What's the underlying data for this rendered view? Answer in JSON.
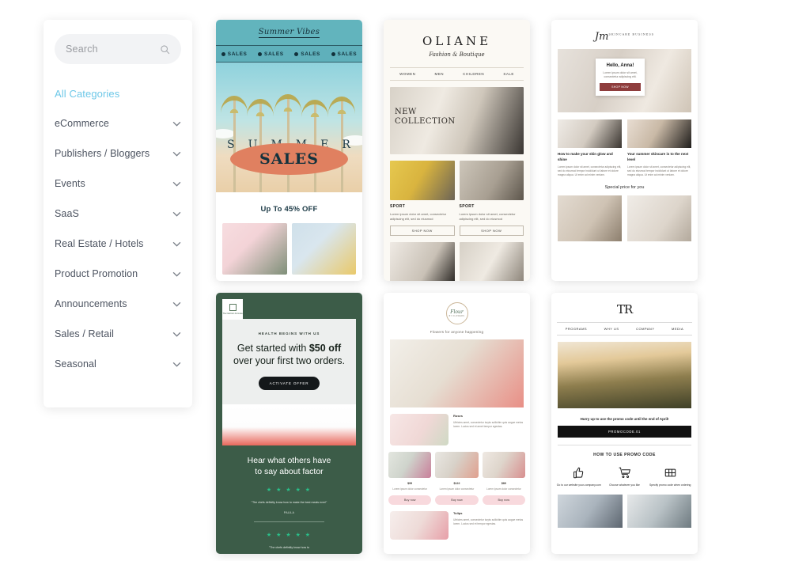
{
  "sidebar": {
    "search": {
      "placeholder": "Search",
      "value": "",
      "icon": "search-icon"
    },
    "all_categories": "All Categories",
    "items": [
      {
        "label": "eCommerce",
        "icon": "chevron-down-icon"
      },
      {
        "label": "Publishers / Bloggers",
        "icon": "chevron-down-icon"
      },
      {
        "label": "Events",
        "icon": "chevron-down-icon"
      },
      {
        "label": "SaaS",
        "icon": "chevron-down-icon"
      },
      {
        "label": "Real Estate / Hotels",
        "icon": "chevron-down-icon"
      },
      {
        "label": "Product Promotion",
        "icon": "chevron-down-icon"
      },
      {
        "label": "Announcements",
        "icon": "chevron-down-icon"
      },
      {
        "label": "Sales / Retail",
        "icon": "chevron-down-icon"
      },
      {
        "label": "Seasonal",
        "icon": "chevron-down-icon"
      }
    ],
    "accent_color": "#6ec8e8"
  },
  "templates": {
    "summer": {
      "brand": "Summer Vibes",
      "ticker": [
        "SALES",
        "SALES",
        "SALES",
        "SALES"
      ],
      "hero_word": [
        "S",
        "U",
        "M",
        "M",
        "E",
        "R"
      ],
      "badge": "SALES",
      "offer": "Up To 45% OFF"
    },
    "oliane": {
      "brand": "OLIANE",
      "tagline": "Fashion & Boutique",
      "nav": [
        "WOMEN",
        "MEN",
        "CHILDREN",
        "SALE"
      ],
      "hero_line1": "NEW",
      "hero_line2": "COLLECTION",
      "products": [
        {
          "tag": "SPORT",
          "text": "Lorem ipsum dolor sit amet, consectetur adipiscing elit, sed do eiusmod",
          "button": "SHOP NOW"
        },
        {
          "tag": "SPORT",
          "text": "Lorem ipsum dolor sit amet, consectetur adipiscing elit, sed do eiusmod",
          "button": "SHOP NOW"
        }
      ]
    },
    "skincare": {
      "logo": "Jm",
      "logo_sub": "SKINCARE BUSINESS",
      "greeting": "Hello, Anna!",
      "greeting_text": "Lorem ipsum dolor sit amet, consectetur adipiscing elit.",
      "greeting_cta": "SHOP NOW",
      "articles": [
        {
          "title": "How to make your skin glow and shine",
          "text": "Lorem ipsum dolor sit amet, consectetur adipiscing elit, sed do eiusmod tempor incididunt ut labore et dolore magna aliqua. Ut enim ad minim veniam."
        },
        {
          "title": "Your summer skincare is to the next level",
          "text": "Lorem ipsum dolor sit amet, consectetur adipiscing elit, sed do eiusmod tempor incididunt ut labore et dolore magna aliqua. Ut enim ad minim veniam."
        }
      ],
      "special": "Special price for you"
    },
    "factor": {
      "logo_text": "The Nutrition Formula",
      "kicker": "HEALTH BEGINS WITH US",
      "headline_1": "Get started with ",
      "headline_strong": "$50 off",
      "headline_2": "over your first two orders.",
      "button": "ACTIVATE OFFER",
      "testimonial_heading_1": "Hear what others have",
      "testimonial_heading_2": "to say about factor",
      "stars": "★ ★ ★ ★ ★",
      "quote_1": "\"The chefs definitly know how to make the best meals ever!\"",
      "author_1": "PAULA",
      "quote_2": "\"The chefs definitly know how to"
    },
    "flowers": {
      "logo": "Flour",
      "logo_sub": "BY FLOWERS",
      "tagline": "Flowers for anyone happening",
      "feature": {
        "title": "Roses",
        "text": "Ultricies amet, consectetur turpis sollicitim quis augue metus lorem. Lucius sed et amet tempor egestas."
      },
      "tiles": [
        {
          "price": "$99",
          "desc": "Lorem ipsum dolor consectetur",
          "button": "Buy now"
        },
        {
          "price": "$122",
          "desc": "Lorem ipsum dolor consectetur",
          "button": "Buy now"
        },
        {
          "price": "$89",
          "desc": "Lorem ipsum dolor consectetur",
          "button": "Buy now"
        }
      ],
      "last": {
        "title": "Tulips",
        "text": "Ultricies amet, consectetur turpis sollicitim quis augue metus lorem. Lucius sed et tempor egestas."
      }
    },
    "promo": {
      "logo": "TR",
      "nav": [
        "PROGRAMS",
        "WHY US",
        "COMPANY",
        "MEDIA"
      ],
      "hurry": "Hurry up to use the promo code until the end of April!",
      "code": "PROMOCODE.01",
      "how_title": "HOW TO USE PROMO CODE",
      "steps": [
        {
          "icon": "thumbs-up-icon",
          "caption": "Go to our website your-company.com"
        },
        {
          "icon": "shopping-cart-icon",
          "caption": "Choose whatever you like"
        },
        {
          "icon": "grid-icon",
          "caption": "Specify promo code when ordering"
        }
      ]
    }
  }
}
